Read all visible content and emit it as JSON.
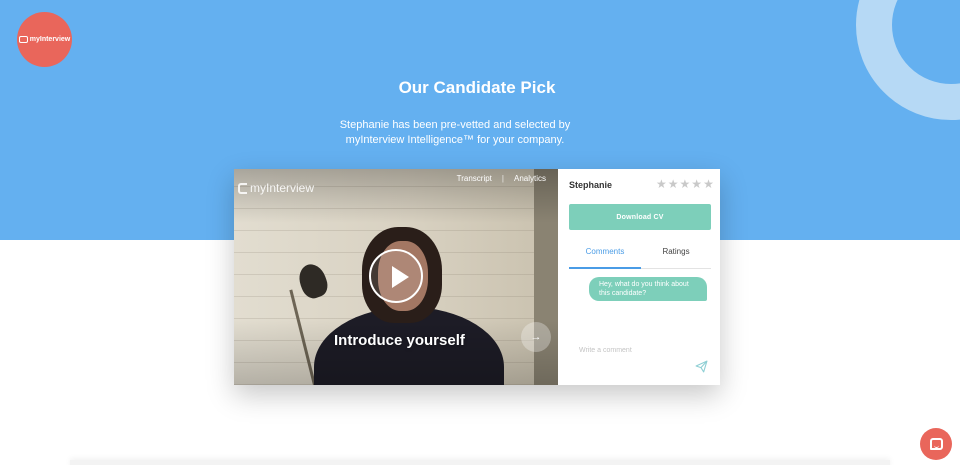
{
  "colors": {
    "hero_bg": "#64b0f0",
    "accent_coral": "#e9665b",
    "accent_teal": "#7dcfba",
    "tab_active": "#4a9ce6"
  },
  "header": {
    "logo_text": "myInterview"
  },
  "hero": {
    "title": "Our Candidate Pick",
    "subtitle_line1": "Stephanie has been pre-vetted and selected by",
    "subtitle_line2": "myInterview Intelligence™ for your company."
  },
  "video": {
    "brand_text": "myInterview",
    "tabs": [
      "Transcript",
      "Analytics"
    ],
    "question": "Introduce yourself",
    "icons": [
      "play-icon",
      "arrow-right-icon"
    ]
  },
  "panel": {
    "candidate_name": "Stephanie",
    "rating": {
      "value": 0,
      "max": 5
    },
    "download_label": "Download CV",
    "tabs": [
      "Comments",
      "Ratings"
    ],
    "active_tab": "Comments",
    "comment_message": "Hey, what do you think about this candidate?",
    "comment_placeholder": "Write a comment",
    "icons": [
      "send-icon",
      "star-icon"
    ]
  },
  "chat_widget": {
    "icon": "chat-icon"
  }
}
